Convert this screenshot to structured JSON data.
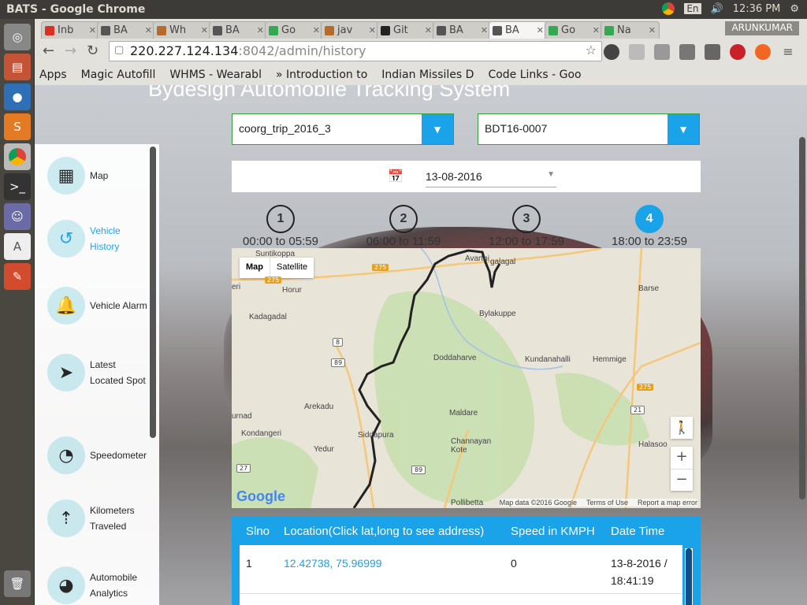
{
  "window": {
    "title": "BATS - Google Chrome"
  },
  "tray": {
    "keyboard": "En",
    "time": "12:36 PM"
  },
  "browser": {
    "tabs": [
      {
        "label": "Inb",
        "color": "#d93025"
      },
      {
        "label": "BA",
        "color": "#555555"
      },
      {
        "label": "Wh",
        "color": "#b36b2e"
      },
      {
        "label": "BA",
        "color": "#555555"
      },
      {
        "label": "Go",
        "color": "#34a853"
      },
      {
        "label": "jav",
        "color": "#b36b2e"
      },
      {
        "label": "Git",
        "color": "#222222"
      },
      {
        "label": "BA",
        "color": "#555555"
      },
      {
        "label": "BA",
        "color": "#555555"
      },
      {
        "label": "Go",
        "color": "#34a853"
      },
      {
        "label": "Na",
        "color": "#34a853"
      }
    ],
    "active_tab": 8,
    "user": "ARUNKUMAR",
    "url_host": "220.227.124.134",
    "url_rest": ":8042/admin/history",
    "bookmarks": [
      "Apps",
      "Magic Autofill",
      "WHMS - Wearabl",
      "» Introduction to",
      "Indian Missiles D",
      "Code Links - Goo"
    ]
  },
  "app": {
    "title": "Bydesign Automobile Tracking System",
    "accent": "#1aa3e8",
    "sidebar": [
      {
        "label": "Map",
        "icon": "map-icon"
      },
      {
        "label": "Vehicle History",
        "icon": "history-icon",
        "selected": true
      },
      {
        "label": "Vehicle Alarm",
        "icon": "bell-icon"
      },
      {
        "label": "Latest Located Spot",
        "icon": "location-arrow-icon"
      },
      {
        "label": "Speedometer",
        "icon": "speedometer-icon"
      },
      {
        "label": "Kilometers Traveled",
        "icon": "kilometers-icon"
      },
      {
        "label": "Automobile Analytics",
        "icon": "pie-chart-icon"
      }
    ],
    "trip_select": "coorg_trip_2016_3",
    "vehicle_select": "BDT16-0007",
    "date": "13-08-2016",
    "steps": [
      {
        "num": "1",
        "label": "00:00 to 05:59"
      },
      {
        "num": "2",
        "label": "06:00 to 11:59"
      },
      {
        "num": "3",
        "label": "12:00 to 17:59"
      },
      {
        "num": "4",
        "label": "18:00 to 23:59",
        "active": true
      }
    ],
    "map": {
      "type_map": "Map",
      "type_satellite": "Satellite",
      "labels": [
        "Suntikoppa",
        "Avarthi",
        "Horur",
        "Bylakuppe",
        "Barse",
        "Kadagadal",
        "Doddaharve",
        "Kundanahalli",
        "Hemmige",
        "Arekadu",
        "Maldare",
        "Kondangeri",
        "Siddapura",
        "Channayan Kote",
        "Yedur",
        "Halasoo",
        "Pollibetta",
        "galagal",
        "eri",
        "urnad"
      ],
      "roads": [
        "275",
        "275",
        "275",
        "8",
        "89",
        "21",
        "27",
        "89"
      ],
      "footer": [
        "Map data ©2016 Google",
        "Terms of Use",
        "Report a map error"
      ],
      "logo": "Google"
    },
    "table": {
      "headers": [
        "Slno",
        "Location(Click lat,long to see address)",
        "Speed in KMPH",
        "Date Time"
      ],
      "rows": [
        {
          "slno": "1",
          "location": "12.42738, 75.96999",
          "speed": "0",
          "datetime": "13-8-2016 / 18:41:19"
        }
      ]
    }
  }
}
